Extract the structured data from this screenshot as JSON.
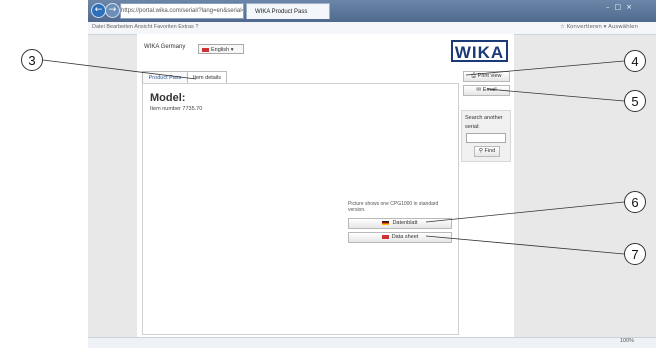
{
  "browser": {
    "address": "https://portal.wika.com/serial/?lang=en&serial=",
    "tab_title": "WIKA Product Pass",
    "nav_back": "←",
    "nav_forward": "→",
    "window_controls": "–□×",
    "menus": "Datei  Bearbeiten  Ansicht  Favoriten  Extras  ?",
    "menu_right": "☆ Konvertieren ▾  Auswählen",
    "zoom": "100%"
  },
  "page": {
    "country": "WIKA Germany",
    "language": "English",
    "logo": "WIKA",
    "tabs": {
      "product_pass": "Product Pass",
      "item_details": "Item details"
    },
    "model_heading": "Model:",
    "item_number": "Item number 7735.70",
    "picture_note": "Picture shows one CPG1000 in standard version.",
    "datenblatt": "Datenblatt",
    "data_sheet": "Data sheet",
    "print_view": "Print view",
    "email": "Email",
    "search_label": "Search another serial:",
    "find": "Find"
  },
  "callouts": {
    "c3": "3",
    "c4": "4",
    "c5": "5",
    "c6": "6",
    "c7": "7"
  },
  "colors": {
    "logo": "#1b3b78",
    "titlebar": "#4f6a8e"
  }
}
